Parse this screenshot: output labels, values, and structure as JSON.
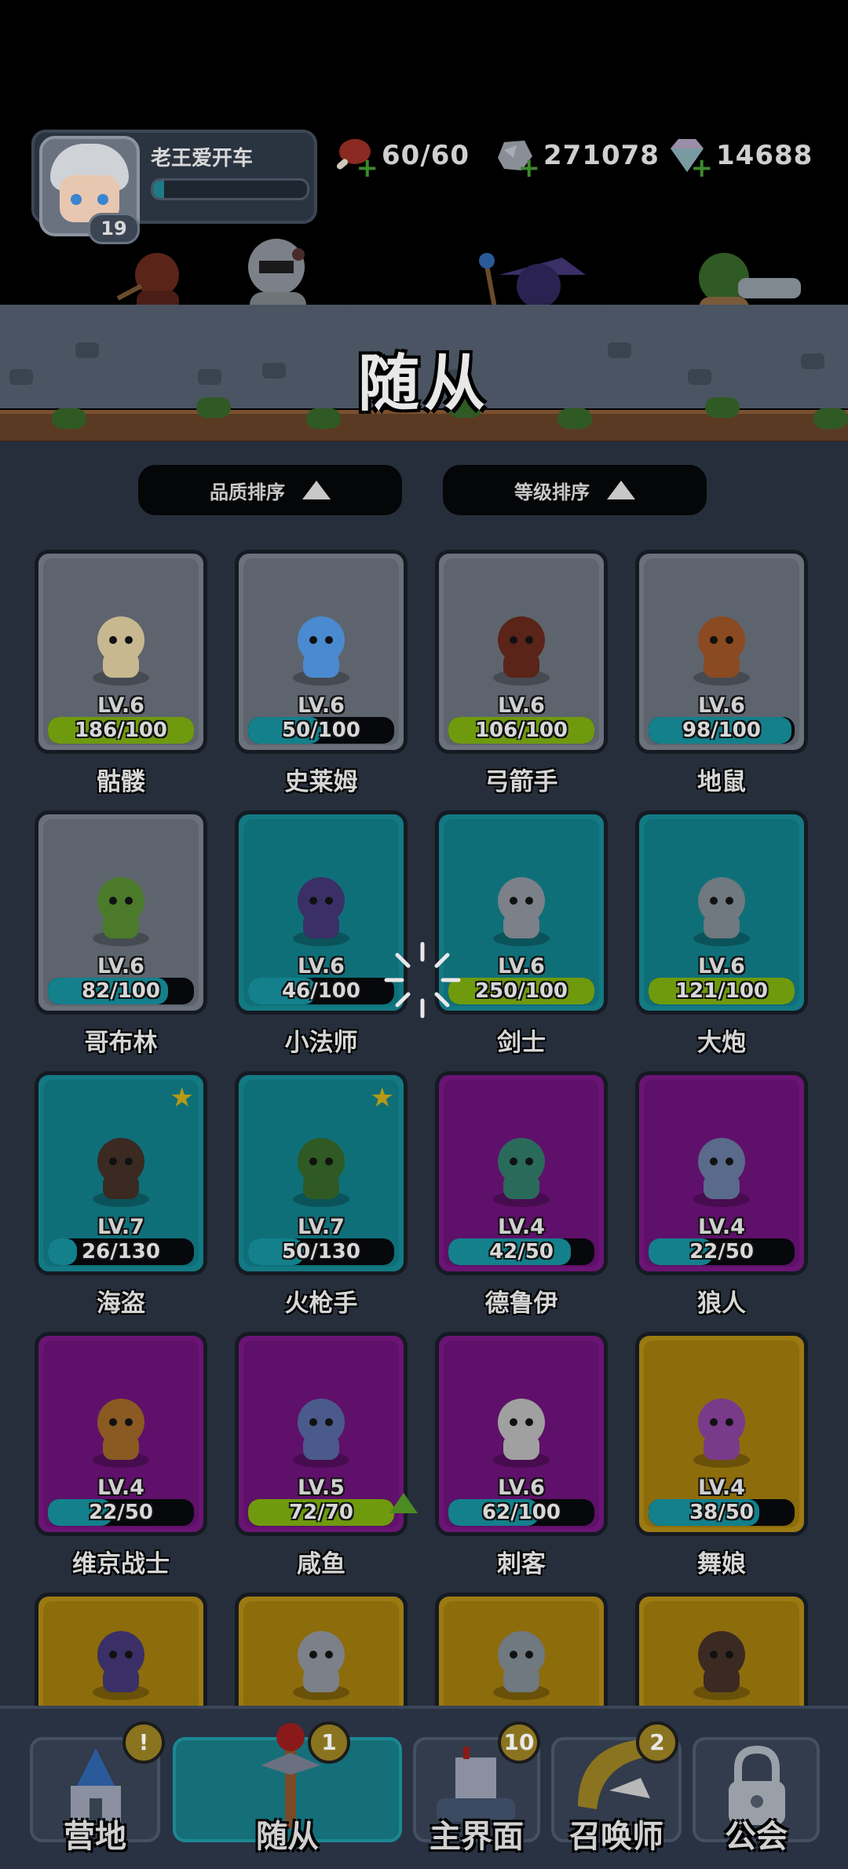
{
  "player": {
    "name": "老王爱开车",
    "level": "19",
    "exp_fraction": 0.07
  },
  "resources": [
    {
      "icon": "meat-icon",
      "value": "60/60"
    },
    {
      "icon": "stone-icon",
      "value": "271078"
    },
    {
      "icon": "diamond-icon",
      "value": "14688"
    }
  ],
  "banner": {
    "title": "随从"
  },
  "sort": {
    "quality_label": "品质排序",
    "level_label": "等级排序"
  },
  "followers": [
    {
      "name": "骷髅",
      "level": "LV.6",
      "progress": "186/100",
      "rarity": "gray",
      "bar_color": "#6f9a0e",
      "fraction": 1.0
    },
    {
      "name": "史莱姆",
      "level": "LV.6",
      "progress": "50/100",
      "rarity": "gray",
      "bar_color": "#13808c",
      "fraction": 0.5
    },
    {
      "name": "弓箭手",
      "level": "LV.6",
      "progress": "106/100",
      "rarity": "gray",
      "bar_color": "#6f9a0e",
      "fraction": 1.0
    },
    {
      "name": "地鼠",
      "level": "LV.6",
      "progress": "98/100",
      "rarity": "gray",
      "bar_color": "#13808c",
      "fraction": 0.98
    },
    {
      "name": "哥布林",
      "level": "LV.6",
      "progress": "82/100",
      "rarity": "gray",
      "bar_color": "#13808c",
      "fraction": 0.82
    },
    {
      "name": "小法师",
      "level": "LV.6",
      "progress": "46/100",
      "rarity": "teal",
      "bar_color": "#13808c",
      "fraction": 0.46
    },
    {
      "name": "剑士",
      "level": "LV.6",
      "progress": "250/100",
      "rarity": "teal",
      "bar_color": "#6f9a0e",
      "fraction": 1.0
    },
    {
      "name": "大炮",
      "level": "LV.6",
      "progress": "121/100",
      "rarity": "teal",
      "bar_color": "#6f9a0e",
      "fraction": 1.0
    },
    {
      "name": "海盗",
      "level": "LV.7",
      "progress": "26/130",
      "rarity": "teal",
      "bar_color": "#13808c",
      "fraction": 0.2,
      "star": true
    },
    {
      "name": "火枪手",
      "level": "LV.7",
      "progress": "50/130",
      "rarity": "teal",
      "bar_color": "#13808c",
      "fraction": 0.38,
      "star": true
    },
    {
      "name": "德鲁伊",
      "level": "LV.4",
      "progress": "42/50",
      "rarity": "purple",
      "bar_color": "#13808c",
      "fraction": 0.84
    },
    {
      "name": "狼人",
      "level": "LV.4",
      "progress": "22/50",
      "rarity": "purple",
      "bar_color": "#13808c",
      "fraction": 0.44
    },
    {
      "name": "维京战士",
      "level": "LV.4",
      "progress": "22/50",
      "rarity": "purple",
      "bar_color": "#13808c",
      "fraction": 0.44
    },
    {
      "name": "咸鱼",
      "level": "LV.5",
      "progress": "72/70",
      "rarity": "purple",
      "bar_color": "#6f9a0e",
      "fraction": 1.0,
      "upgrade": true
    },
    {
      "name": "刺客",
      "level": "LV.6",
      "progress": "62/100",
      "rarity": "purple",
      "bar_color": "#13808c",
      "fraction": 0.62
    },
    {
      "name": "舞娘",
      "level": "LV.4",
      "progress": "38/50",
      "rarity": "gold",
      "bar_color": "#13808c",
      "fraction": 0.76
    }
  ],
  "partial_cards": [
    {
      "rarity": "gold",
      "icon": "panda-icon"
    },
    {
      "rarity": "gold",
      "icon": "golem-icon"
    },
    {
      "rarity": "gold",
      "icon": "ninja-icon"
    },
    {
      "rarity": "gold",
      "icon": "lucky-cat-icon"
    }
  ],
  "nav": [
    {
      "label": "营地",
      "badge": "!",
      "icon": "castle-icon"
    },
    {
      "label": "随从",
      "badge": "1",
      "icon": "scepter-icon",
      "active": true
    },
    {
      "label": "主界面",
      "badge": "10",
      "icon": "tower-icon"
    },
    {
      "label": "召唤师",
      "badge": "2",
      "icon": "horn-icon"
    },
    {
      "label": "公会",
      "badge": "",
      "icon": "lock-icon"
    }
  ],
  "colors": {
    "gray": "#6b717b",
    "teal": "#137983",
    "purple": "#6a1474",
    "gold": "#9c7a12",
    "bar_full": "#6f9a0e",
    "bar_partial": "#13808c"
  }
}
